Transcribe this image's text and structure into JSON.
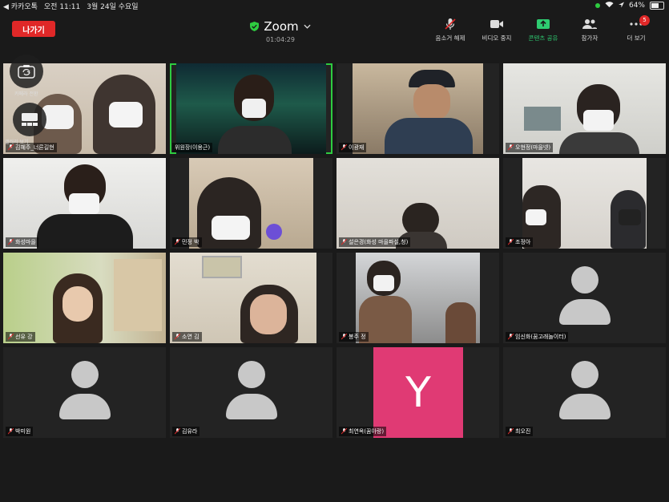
{
  "status_bar": {
    "back_app": "◀ 카카오톡",
    "time": "오전 11:11",
    "date": "3월 24일 수요일",
    "battery": "64%",
    "battery_level": 0.64
  },
  "toolbar": {
    "leave_label": "나가기",
    "title": "Zoom",
    "timer": "01:04:29",
    "buttons": [
      {
        "label": "음소거 해제",
        "icon": "mic-off-icon"
      },
      {
        "label": "비디오 중지",
        "icon": "video-icon"
      },
      {
        "label": "콘텐츠 공유",
        "icon": "share-icon"
      },
      {
        "label": "참가자",
        "icon": "participants-icon"
      },
      {
        "label": "더 보기",
        "icon": "more-icon",
        "badge": "5"
      }
    ]
  },
  "floating": {
    "camera_switch_label": "카메라 전환",
    "view_switch_label": "갤러리 보기"
  },
  "participants": [
    {
      "name": "김혜주_너른길현"
    },
    {
      "name": "위원장(이용근)"
    },
    {
      "name": "이광재"
    },
    {
      "name": "오현정(마을넷)"
    },
    {
      "name": "화성마을"
    },
    {
      "name": "민정 박"
    },
    {
      "name": "설은경(화성 마을파실,청)"
    },
    {
      "name": "조정아"
    },
    {
      "name": "선유 강"
    },
    {
      "name": "소연 김"
    },
    {
      "name": "봉주 정"
    },
    {
      "name": "임신화(꿈고래놀이터)"
    },
    {
      "name": "박미원"
    },
    {
      "name": "김유라"
    },
    {
      "name": "최연옥(꿈아랑)",
      "initial": "Y"
    },
    {
      "name": "최오진"
    }
  ]
}
